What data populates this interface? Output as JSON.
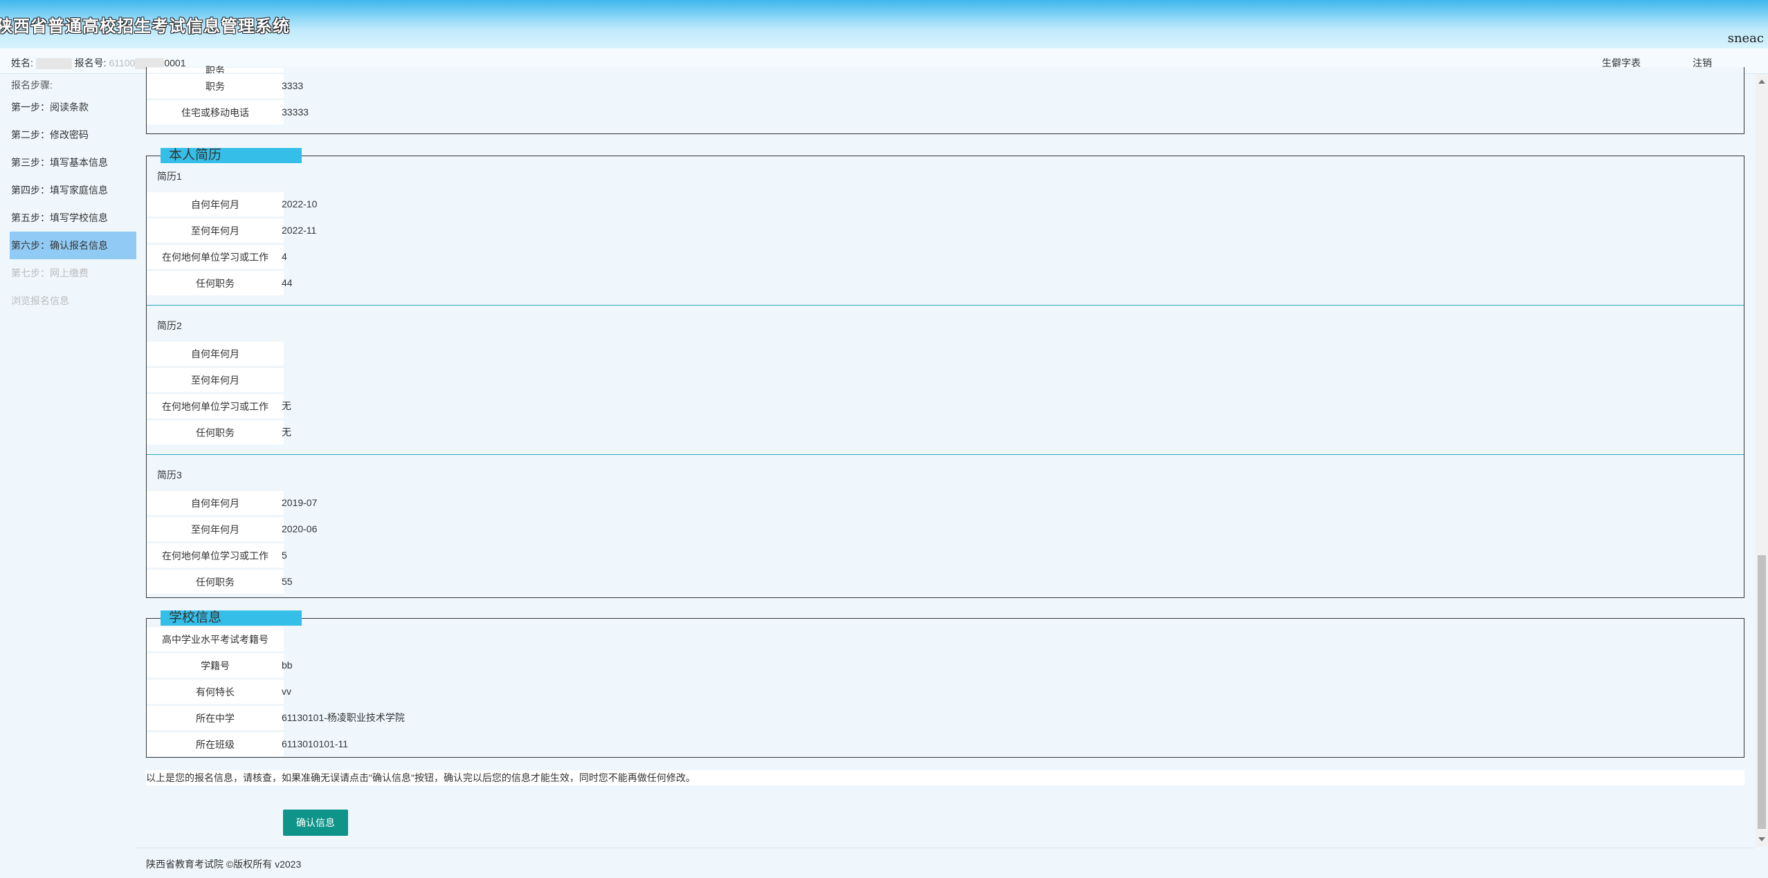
{
  "header": {
    "title": "陕西省普通高校招生考试信息管理系统",
    "brand": "sneac"
  },
  "topbar": {
    "name_label": "姓名:",
    "reg_label": "报名号:",
    "reg_prefix": "61100",
    "reg_suffix": "0001",
    "link_sheet": "生僻字表",
    "link_logout": "注销"
  },
  "sidebar": {
    "header": "报名步骤:",
    "items": [
      {
        "label": "第一步：阅读条款"
      },
      {
        "label": "第二步：修改密码"
      },
      {
        "label": "第三步：填写基本信息"
      },
      {
        "label": "第四步：填写家庭信息"
      },
      {
        "label": "第五步：填写学校信息"
      },
      {
        "label": "第六步：确认报名信息"
      },
      {
        "label": "第七步：网上缴费"
      },
      {
        "label": "浏览报名信息"
      }
    ]
  },
  "family": {
    "rows": [
      {
        "label": "职务",
        "value": "3333"
      },
      {
        "label": "住宅或移动电话",
        "value": "33333"
      }
    ]
  },
  "resume": {
    "title": "本人简历",
    "entries": [
      {
        "name": "简历1",
        "from": "2022-10",
        "to": "2022-11",
        "where": "4",
        "position": "44"
      },
      {
        "name": "简历2",
        "from": "",
        "to": "",
        "where": "无",
        "position": "无"
      },
      {
        "name": "简历3",
        "from": "2019-07",
        "to": "2020-06",
        "where": "5",
        "position": "55"
      }
    ],
    "labels": {
      "from": "自何年何月",
      "to": "至何年何月",
      "where": "在何地何单位学习或工作",
      "position": "任何职务"
    }
  },
  "school": {
    "title": "学校信息",
    "rows": [
      {
        "label": "高中学业水平考试考籍号",
        "value": ""
      },
      {
        "label": "学籍号",
        "value": "bb"
      },
      {
        "label": "有何特长",
        "value": "vv"
      },
      {
        "label": "所在中学",
        "value": "61130101-杨凌职业技术学院"
      },
      {
        "label": "所在班级",
        "value": "6113010101-11"
      }
    ]
  },
  "notice": "以上是您的报名信息，请核查，如果准确无误请点击\"确认信息\"按钮，确认完以后您的信息才能生效，同时您不能再做任何修改。",
  "confirm_label": "确认信息",
  "footer": "陕西省教育考试院 ©版权所有 v2023"
}
